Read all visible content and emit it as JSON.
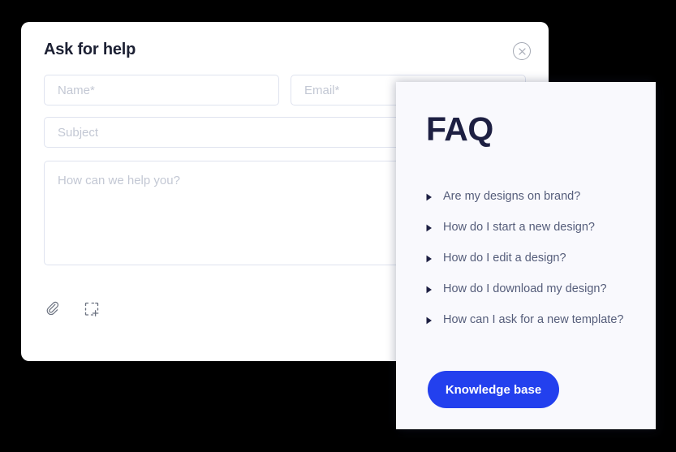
{
  "help_card": {
    "title": "Ask for help",
    "close_icon": "close-circle-icon",
    "fields": {
      "name": {
        "value": "",
        "placeholder": "Name*"
      },
      "email": {
        "value": "",
        "placeholder": "Email*"
      },
      "subject": {
        "value": "",
        "placeholder": "Subject"
      },
      "message": {
        "value": "",
        "placeholder": "How can we help you?"
      }
    },
    "attachments": [
      {
        "icon": "paperclip-icon",
        "label": "Attach file"
      },
      {
        "icon": "screenshot-add-icon",
        "label": "Add screenshot"
      }
    ]
  },
  "faq_panel": {
    "title": "FAQ",
    "items": [
      {
        "label": "Are my designs on brand?"
      },
      {
        "label": "How do I start a new design?"
      },
      {
        "label": "How do I edit a design?"
      },
      {
        "label": "How do I download my design?"
      },
      {
        "label": "How can I ask for a new template?"
      }
    ],
    "button": {
      "label": "Knowledge base"
    }
  },
  "colors": {
    "background": "#000000",
    "card": "#ffffff",
    "faq_panel": "#f9f9fd",
    "title_navy": "#1c2033",
    "faq_title_navy": "#1d1f42",
    "faq_text": "#555d7a",
    "placeholder": "#c3c8d4",
    "field_border": "#dfe3ef",
    "accent_blue": "#2340ee",
    "close_gray": "#a3a8b3",
    "icon_gray": "#6b7280"
  }
}
